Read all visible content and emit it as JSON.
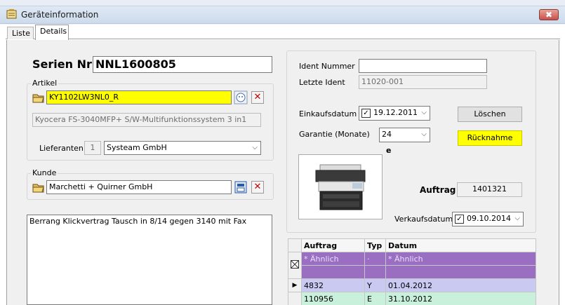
{
  "window": {
    "title": "Geräteinformation",
    "close_label": "✖"
  },
  "tabs": [
    {
      "label": "Liste"
    },
    {
      "label": "Details"
    }
  ],
  "serien": {
    "label": "Serien Nr",
    "value": "NNL1600805"
  },
  "artikel": {
    "group_label": "Artikel",
    "code": "KY1102LW3NL0_R",
    "description": "Kyocera FS-3040MFP+ S/W-Multifunktionssystem 3 in1",
    "lieferanten_label": "Lieferanten",
    "lieferanten_nr": "1",
    "lieferant": "Systeam GmbH"
  },
  "kunde": {
    "group_label": "Kunde",
    "name": "Marchetti + Quirner GmbH"
  },
  "notes": "Berrang Klickvertrag  Tausch in 8/14 gegen 3140 mit Fax",
  "ident": {
    "ident_label": "Ident Nummer",
    "ident_value": "",
    "letzte_label": "Letzte Ident",
    "letzte_value": "11020-001"
  },
  "einkauf": {
    "label": "Einkaufsdatum",
    "value": "19.12.2011",
    "checked": true
  },
  "garantie": {
    "label": "Garantie (Monate)",
    "value": "24"
  },
  "buttons": {
    "loeschen": "Löschen",
    "ruecknahme": "Rücknahme"
  },
  "stray_char": "e",
  "auftrag": {
    "label": "Auftrag",
    "value": "1401321"
  },
  "verkauf": {
    "label": "Verkaufsdatum",
    "value": "09.10.2014",
    "checked": true
  },
  "grid": {
    "headers": [
      "Auftrag",
      "Typ",
      "Datum"
    ],
    "filter_row": [
      "Ähnlich",
      "",
      "Ähnlich"
    ],
    "rows": [
      {
        "auftrag": "4832",
        "typ": "Y",
        "datum": "01.04.2012"
      },
      {
        "auftrag": "110956",
        "typ": "E",
        "datum": "31.10.2012"
      }
    ]
  },
  "colors": {
    "highlight": "#ffff00",
    "filter_row": "#9a6fc2",
    "row1": "#c9c9f2",
    "row2": "#c8f0da"
  }
}
